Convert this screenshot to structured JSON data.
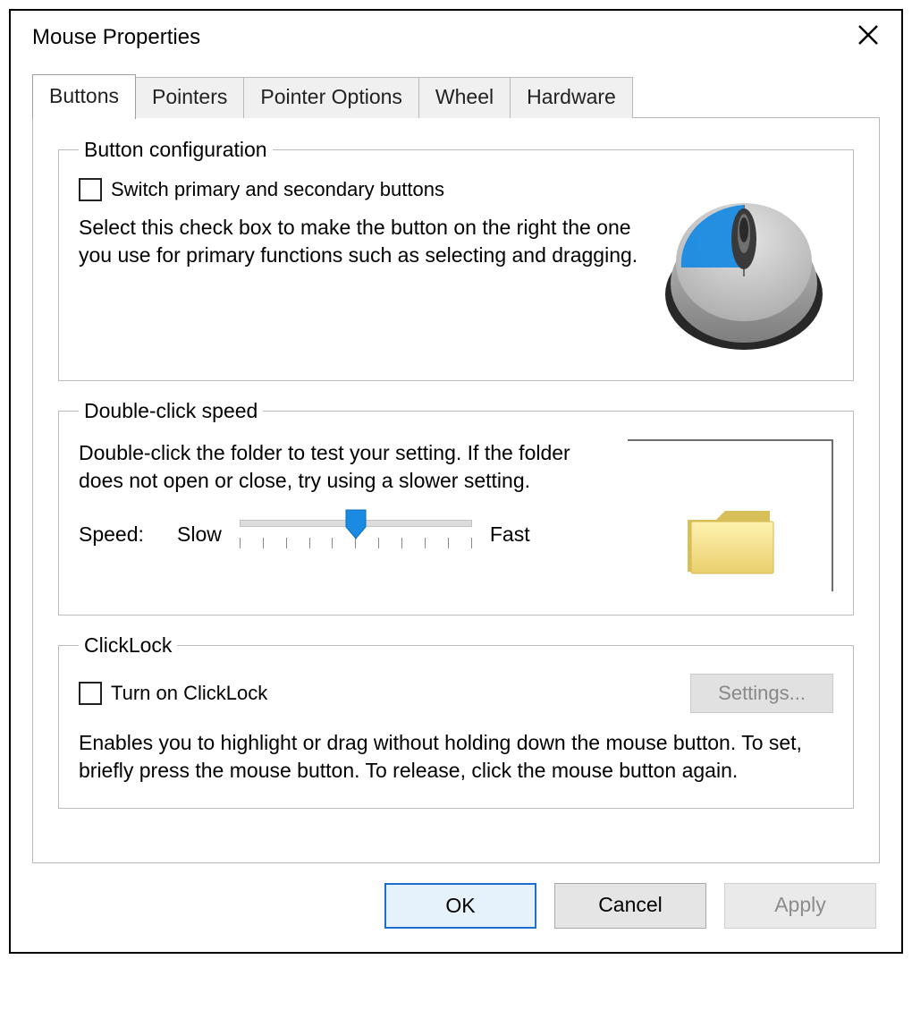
{
  "window": {
    "title": "Mouse Properties"
  },
  "tabs": {
    "items": [
      "Buttons",
      "Pointers",
      "Pointer Options",
      "Wheel",
      "Hardware"
    ],
    "active_index": 0
  },
  "group_button_config": {
    "legend": "Button configuration",
    "checkbox_label": "Switch primary and secondary buttons",
    "checkbox_checked": false,
    "description": "Select this check box to make the button on the right the one you use for primary functions such as selecting and dragging."
  },
  "group_double_click": {
    "legend": "Double-click speed",
    "description": "Double-click the folder to test your setting. If the folder does not open or close, try using a slower setting.",
    "speed_label": "Speed:",
    "slow_label": "Slow",
    "fast_label": "Fast",
    "slider": {
      "min": 0,
      "max": 10,
      "value": 5
    }
  },
  "group_clicklock": {
    "legend": "ClickLock",
    "checkbox_label": "Turn on ClickLock",
    "checkbox_checked": false,
    "settings_button": "Settings...",
    "settings_enabled": false,
    "description": "Enables you to highlight or drag without holding down the mouse button. To set, briefly press the mouse button. To release, click the mouse button again."
  },
  "buttons": {
    "ok": "OK",
    "cancel": "Cancel",
    "apply": "Apply",
    "apply_enabled": false
  },
  "colors": {
    "accent": "#1a8ae2"
  }
}
